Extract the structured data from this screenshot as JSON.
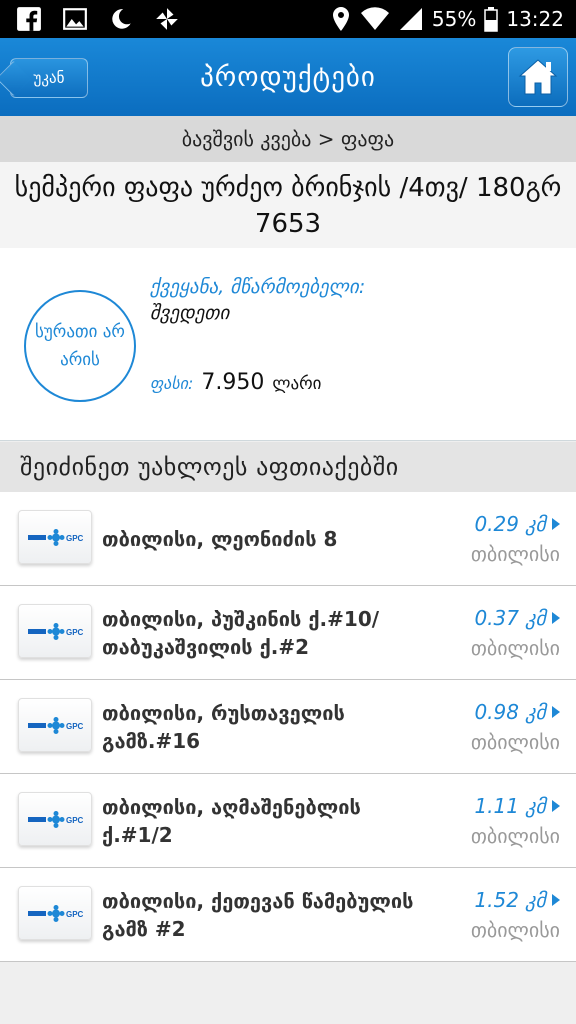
{
  "status_bar": {
    "battery": "55%",
    "time": "13:22",
    "icons": [
      "facebook-icon",
      "image-icon",
      "moon-icon",
      "pinwheel-icon",
      "location-icon",
      "wifi-icon",
      "signal-icon",
      "battery-icon"
    ]
  },
  "app_bar": {
    "back_label": "უკან",
    "title": "პროდუქტები",
    "home_icon": "home-icon"
  },
  "breadcrumb": "ბავშვის კვება > ფაფა",
  "product": {
    "name": "სემპერი ფაფა ურძეო ბრინჯის /4თვ/ 180გრ 7653",
    "no_image_text": "სურათი არ არის",
    "origin_label": "ქვეყანა, მწარმოებელი:",
    "origin_value": "შვედეთი",
    "price_label": "ფასი:",
    "price": "7.950",
    "currency": "ლარი"
  },
  "section_title": "შეიძინეთ უახლოეს აფთიაქებში",
  "stations": [
    {
      "address": "თბილისი, ლეონიძის 8",
      "distance": "0.29 კმ",
      "city": "თბილისი"
    },
    {
      "address": "თბილისი, პუშკინის ქ.#10/ თაბუკაშვილის ქ.#2",
      "distance": "0.37 კმ",
      "city": "თბილისი"
    },
    {
      "address": "თბილისი, რუსთაველის გამზ.#16",
      "distance": "0.98 კმ",
      "city": "თბილისი"
    },
    {
      "address": "თბილისი, აღმაშენებლის ქ.#1/2",
      "distance": "1.11 კმ",
      "city": "თბილისი"
    },
    {
      "address": "თბილისი, ქეთევან წამებულის გამზ #2",
      "distance": "1.52 კმ",
      "city": "თბილისი"
    }
  ],
  "logo_text": "GPC",
  "colors": {
    "accent": "#1e88d6",
    "appbar": "#0b6dbf"
  }
}
